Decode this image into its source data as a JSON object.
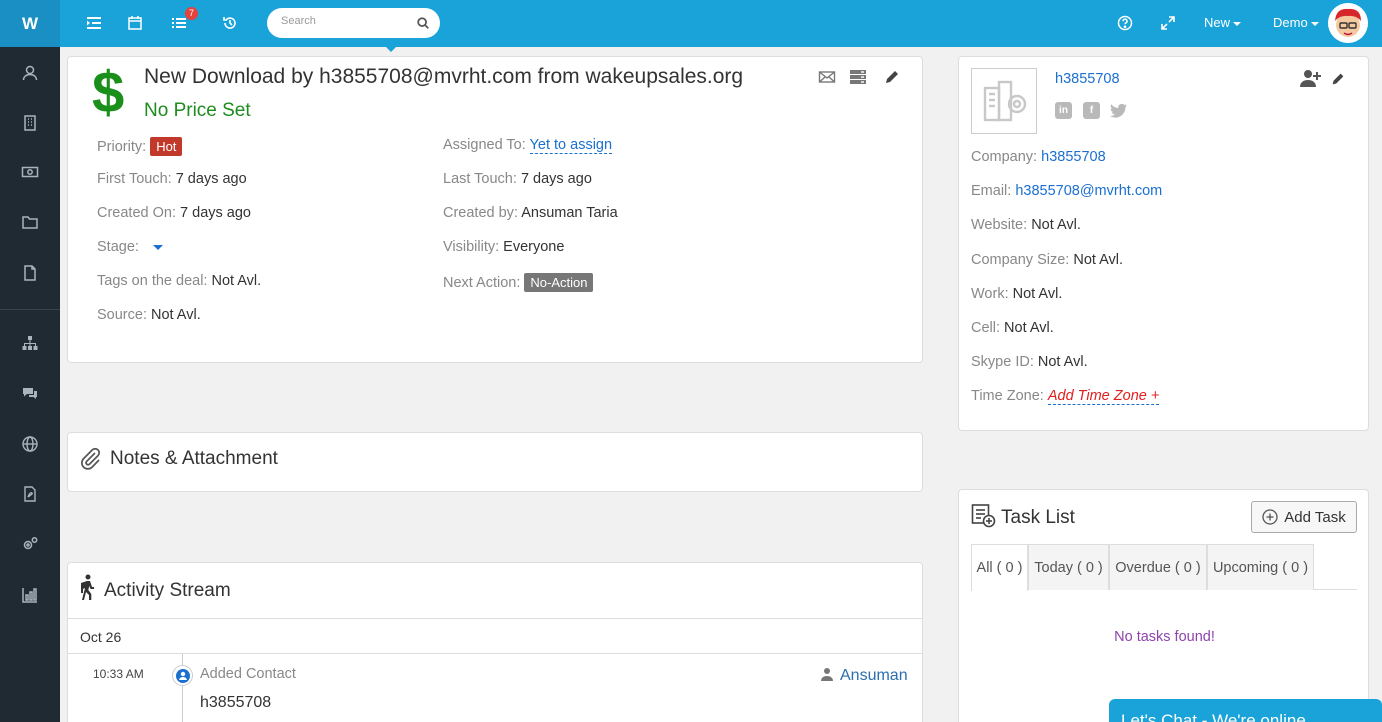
{
  "app": {
    "logo": "W",
    "notification_count": "7"
  },
  "header": {
    "search_placeholder": "Search",
    "new_label": "New",
    "user_label": "Demo"
  },
  "deal": {
    "title": "New Download by h3855708@mvrht.com from wakeupsales.org",
    "price": "No Price Set",
    "currency_symbol": "$",
    "fields": {
      "priority_label": "Priority:",
      "priority_value": "Hot",
      "assigned_label": "Assigned To:",
      "assigned_value": "Yet to assign",
      "first_touch_label": "First Touch:",
      "first_touch_value": "7 days ago",
      "last_touch_label": "Last Touch:",
      "last_touch_value": "7 days ago",
      "created_on_label": "Created On:",
      "created_on_value": "7 days ago",
      "created_by_label": "Created by:",
      "created_by_value": "Ansuman Taria",
      "stage_label": "Stage:",
      "visibility_label": "Visibility:",
      "visibility_value": "Everyone",
      "tags_label": "Tags on the deal:",
      "tags_value": "Not Avl.",
      "next_action_label": "Next Action:",
      "next_action_value": "No-Action",
      "source_label": "Source:",
      "source_value": "Not Avl."
    }
  },
  "notes": {
    "title": "Notes & Attachment"
  },
  "activity": {
    "title": "Activity Stream",
    "date": "Oct 26",
    "entry": {
      "time": "10:33 AM",
      "action": "Added Contact",
      "subject": "h3855708",
      "user": "Ansuman"
    }
  },
  "contact": {
    "name": "h3855708",
    "company_label": "Company:",
    "company_value": "h3855708",
    "email_label": "Email:",
    "email_value": "h3855708@mvrht.com",
    "website_label": "Website:",
    "website_value": "Not Avl.",
    "company_size_label": "Company Size:",
    "company_size_value": "Not Avl.",
    "work_label": "Work:",
    "work_value": "Not Avl.",
    "cell_label": "Cell:",
    "cell_value": "Not Avl.",
    "skype_label": "Skype ID:",
    "skype_value": "Not Avl.",
    "timezone_label": "Time Zone:",
    "timezone_value": "Add Time Zone +"
  },
  "tasks": {
    "title": "Task List",
    "add_label": "Add Task",
    "tabs": [
      "All ( 0 )",
      "Today ( 0 )",
      "Overdue ( 0 )",
      "Upcoming ( 0 )"
    ],
    "empty_text": "No tasks found!"
  },
  "chat": {
    "label": "Let's Chat - We're online"
  },
  "colors": {
    "topbar": "#1aa3d9",
    "sidebar": "#1f2a33",
    "link": "#1a6fd1",
    "price": "#1e8c1e",
    "hot": "#c0392b",
    "empty": "#8e44ad"
  }
}
